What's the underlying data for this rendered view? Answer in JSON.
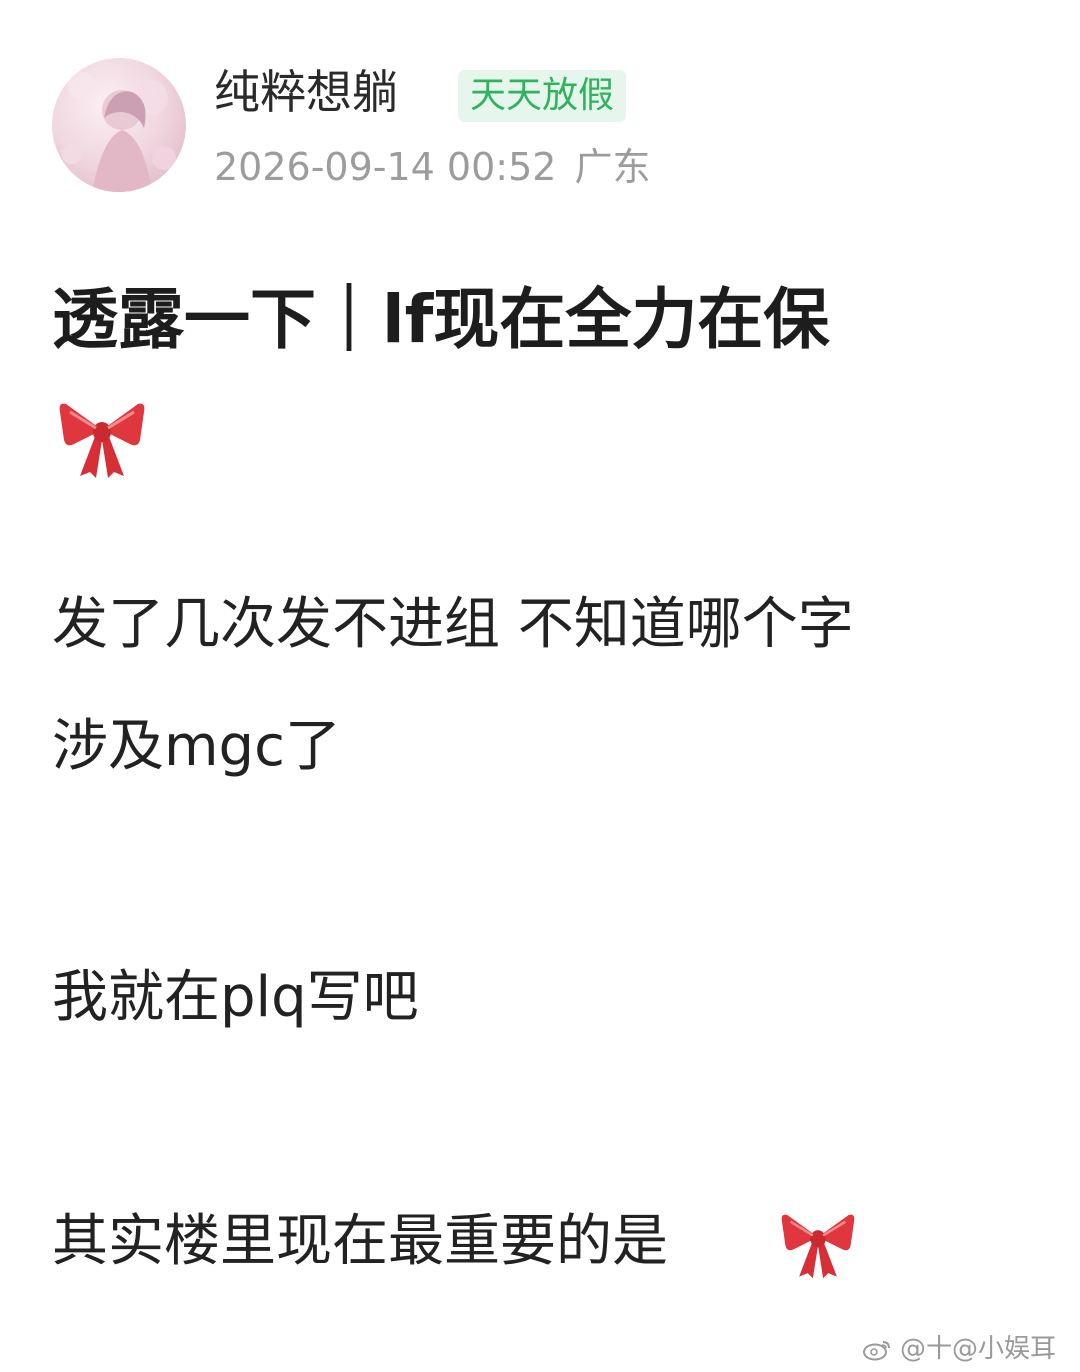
{
  "post": {
    "author": {
      "name": "纯粹想躺",
      "badge": "天天放假",
      "avatar_icon": "avatar-image"
    },
    "timestamp": "2026-09-14 00:52",
    "location": "广东",
    "title": "透露一下｜lf现在全力在保",
    "decoration_icon": "ribbon-bow-emoji",
    "body": {
      "line1": "发了几次发不进组 不知道哪个字",
      "line2": "涉及mgc了",
      "line3": "我就在plq写吧",
      "line4": "其实楼里现在最重要的是"
    }
  },
  "watermark": {
    "text": "@十@小娱耳",
    "icon": "weibo-icon"
  },
  "colors": {
    "badge_text": "#2fb35d",
    "badge_bg": "#e7f6ec",
    "meta_text": "#9c9c9c",
    "bow_red": "#e0363d"
  }
}
